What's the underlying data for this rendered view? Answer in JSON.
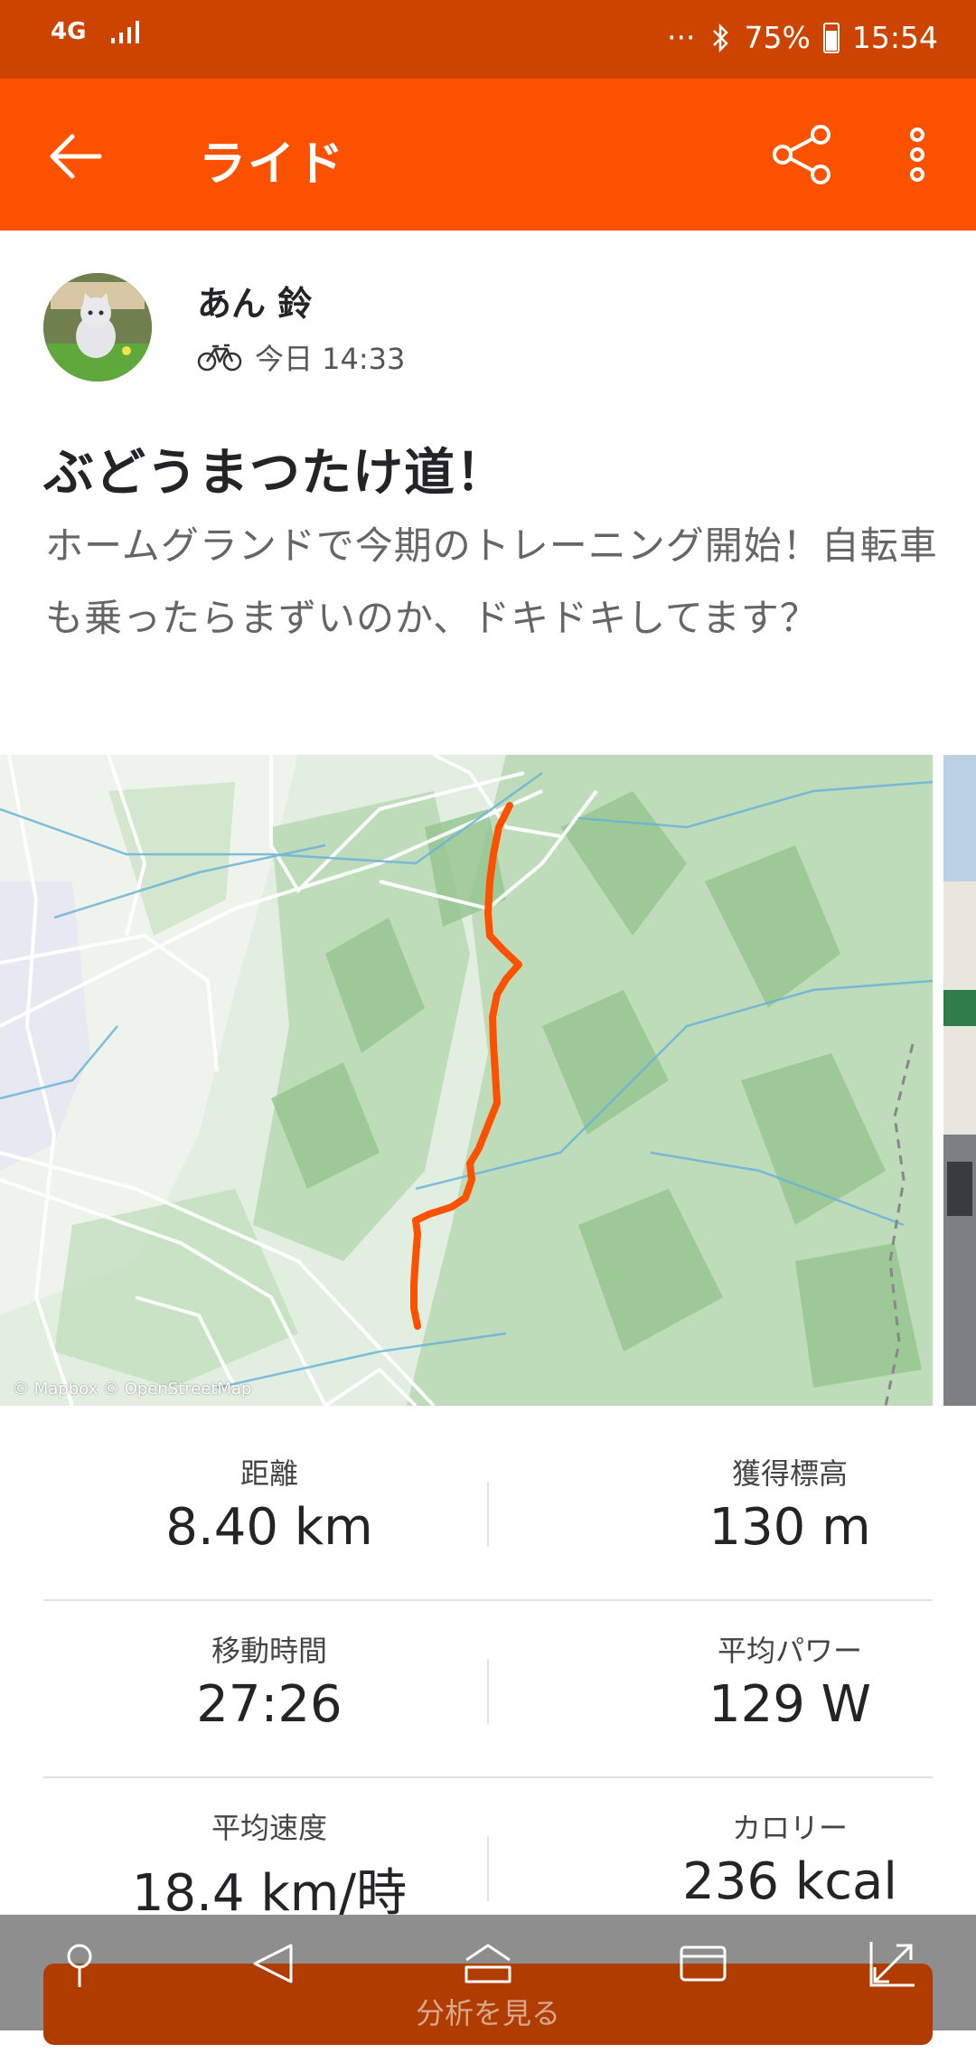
{
  "status_bar": {
    "network": "4G",
    "dots": "···",
    "battery_percent": "75%",
    "time": "15:54"
  },
  "app_bar": {
    "title": "ライド"
  },
  "activity": {
    "athlete_name": "あん 鈴",
    "date": "今日 14:33",
    "title": "ぶどうまつたけ道！",
    "description": "ホームグランドで今期のトレーニング開始！自転車も乗ったらまずいのか、ドキドキしてます？"
  },
  "map": {
    "attribution": "© Mapbox © OpenStreetMap"
  },
  "stats": [
    {
      "left_label": "距離",
      "left_value": "8.40 km",
      "right_label": "獲得標高",
      "right_value": "130 m"
    },
    {
      "left_label": "移動時間",
      "left_value": "27:26",
      "right_label": "平均パワー",
      "right_value": "129 W"
    },
    {
      "left_label": "平均速度",
      "left_value": "18.4 km/時",
      "right_label": "カロリー",
      "right_value": "236 kcal"
    }
  ],
  "bottom": {
    "analyze_label": "分析を見る"
  },
  "colors": {
    "brand": "#fc5200",
    "status_bar": "#cc4400",
    "route": "#fc5200"
  }
}
